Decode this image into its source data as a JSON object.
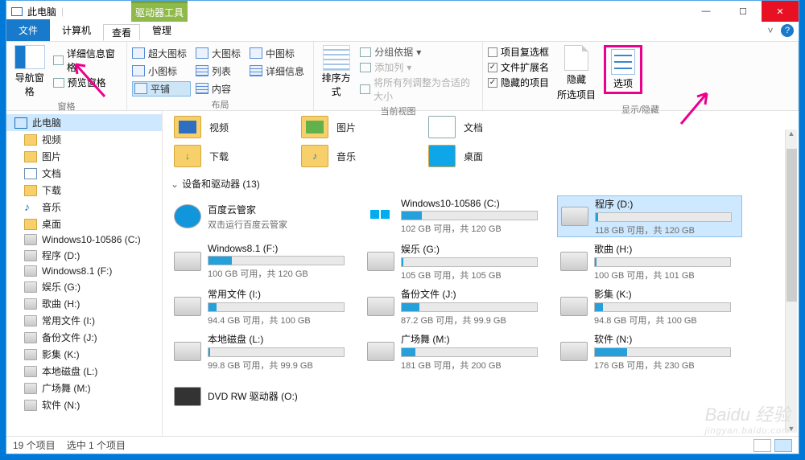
{
  "titlebar": {
    "title": "此电脑",
    "drive_tools": "驱动器工具"
  },
  "tabs": {
    "file": "文件",
    "computer": "计算机",
    "view": "查看",
    "manage": "管理"
  },
  "ribbon": {
    "nav": {
      "details_pane": "详细信息窗格",
      "nav_pane": "导航窗格",
      "preview_pane": "预览窗格",
      "group": "窗格"
    },
    "layout": {
      "extra_large": "超大图标",
      "large": "大图标",
      "medium": "中图标",
      "small": "小图标",
      "list": "列表",
      "details": "详细信息",
      "tiles": "平铺",
      "content": "内容",
      "group": "布局"
    },
    "sort": {
      "sort_by": "排序方式",
      "group_by": "分组依据",
      "add_columns": "添加列",
      "size_all": "将所有列调整为合适的大小",
      "group": "当前视图"
    },
    "show": {
      "item_checkboxes": "项目复选框",
      "file_ext": "文件扩展名",
      "hidden_items": "隐藏的项目",
      "hide": "隐藏",
      "selected": "所选项目",
      "options": "选项",
      "group": "显示/隐藏"
    }
  },
  "tree": [
    {
      "label": "此电脑",
      "ico": "ico-pc",
      "top": true
    },
    {
      "label": "视频",
      "ico": "ico-folder"
    },
    {
      "label": "图片",
      "ico": "ico-folder"
    },
    {
      "label": "文档",
      "ico": "ico-doc"
    },
    {
      "label": "下载",
      "ico": "ico-folder"
    },
    {
      "label": "音乐",
      "ico": "ico-music",
      "glyph": "♪"
    },
    {
      "label": "桌面",
      "ico": "ico-folder"
    },
    {
      "label": "Windows10-10586 (C:)",
      "ico": "ico-drive"
    },
    {
      "label": "程序 (D:)",
      "ico": "ico-drive"
    },
    {
      "label": "Windows8.1 (F:)",
      "ico": "ico-drive"
    },
    {
      "label": "娱乐 (G:)",
      "ico": "ico-drive"
    },
    {
      "label": "歌曲 (H:)",
      "ico": "ico-drive"
    },
    {
      "label": "常用文件 (I:)",
      "ico": "ico-drive"
    },
    {
      "label": "备份文件 (J:)",
      "ico": "ico-drive"
    },
    {
      "label": "影集 (K:)",
      "ico": "ico-drive"
    },
    {
      "label": "本地磁盘 (L:)",
      "ico": "ico-drive"
    },
    {
      "label": "广场舞 (M:)",
      "ico": "ico-drive"
    },
    {
      "label": "软件 (N:)",
      "ico": "ico-drive"
    }
  ],
  "folders_row1": [
    {
      "name": "视频",
      "cls": "video"
    },
    {
      "name": "图片",
      "cls": "pic"
    },
    {
      "name": "文档",
      "cls": "doc"
    }
  ],
  "folders_row2": [
    {
      "name": "下载",
      "cls": "dl"
    },
    {
      "name": "音乐",
      "cls": "music"
    },
    {
      "name": "桌面",
      "cls": "desk"
    }
  ],
  "section_drives": "设备和驱动器 (13)",
  "drives": [
    {
      "name": "百度云管家",
      "sub": "双击运行百度云管家",
      "ico": "baidu",
      "bar": null
    },
    {
      "name": "Windows10-10586 (C:)",
      "sub": "102 GB 可用，共 120 GB",
      "ico": "win",
      "bar": 15
    },
    {
      "name": "程序 (D:)",
      "sub": "118 GB 可用，共 120 GB",
      "ico": "",
      "bar": 2,
      "sel": true
    },
    {
      "name": "Windows8.1 (F:)",
      "sub": "100 GB 可用，共 120 GB",
      "ico": "",
      "bar": 17
    },
    {
      "name": "娱乐 (G:)",
      "sub": "105 GB 可用，共 105 GB",
      "ico": "",
      "bar": 1
    },
    {
      "name": "歌曲 (H:)",
      "sub": "100 GB 可用，共 101 GB",
      "ico": "",
      "bar": 1
    },
    {
      "name": "常用文件 (I:)",
      "sub": "94.4 GB 可用，共 100 GB",
      "ico": "",
      "bar": 6
    },
    {
      "name": "备份文件 (J:)",
      "sub": "87.2 GB 可用，共 99.9 GB",
      "ico": "",
      "bar": 13
    },
    {
      "name": "影集 (K:)",
      "sub": "94.8 GB 可用，共 100 GB",
      "ico": "",
      "bar": 6
    },
    {
      "name": "本地磁盘 (L:)",
      "sub": "99.8 GB 可用，共 99.9 GB",
      "ico": "",
      "bar": 1
    },
    {
      "name": "广场舞 (M:)",
      "sub": "181 GB 可用，共 200 GB",
      "ico": "",
      "bar": 10
    },
    {
      "name": "软件 (N:)",
      "sub": "176 GB 可用，共 230 GB",
      "ico": "",
      "bar": 24
    },
    {
      "name": "DVD RW 驱动器 (O:)",
      "sub": "",
      "ico": "dvd",
      "bar": null
    }
  ],
  "status": {
    "count": "19 个项目",
    "selected": "选中 1 个项目"
  },
  "watermark": {
    "main": "Baidu 经验",
    "sub": "jingyan.baidu.com"
  }
}
